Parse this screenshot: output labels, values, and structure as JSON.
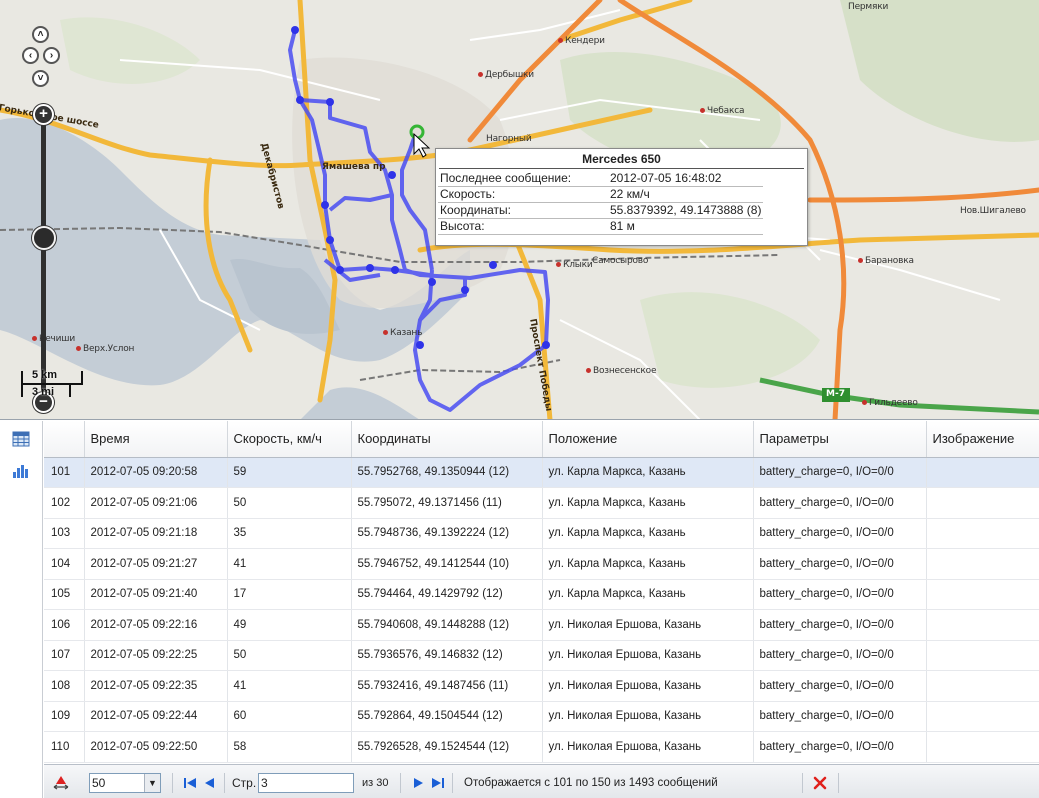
{
  "map": {
    "places": {
      "permyaki": "Пермяки",
      "kendery": "Кендери",
      "derbyshki": "Дербышки",
      "chebaksa": "Чебакса",
      "nagorny": "Нагорный",
      "nov_shigalevo": "Нов.Шигалево",
      "klyki": "Клыки",
      "samosyrovo": "Самосырово",
      "baranovka": "Барановка",
      "kazan": "Казань",
      "verkh_uslon": "Верх.Услон",
      "kurlachi": "Кечиши",
      "voznesenskoe": "Вознесенское",
      "gildeevo": "Гильдеево"
    },
    "roads": {
      "gorkovskoe": "Горьковское шоссе",
      "dekabristov": "Декабристов",
      "yamasheva": "Ямашева пр",
      "pobedy": "Проспект Победы",
      "m7": "М-7"
    },
    "scale": {
      "km": "5 km",
      "mi": "3 mi"
    },
    "controls": {
      "pan_up": "˄",
      "pan_left": "‹",
      "pan_right": "›",
      "pan_down": "˅",
      "zoom_in": "+",
      "zoom_out": "−"
    }
  },
  "popup": {
    "title": "Mercedes 650",
    "rows": [
      {
        "k": "Последнее сообщение:",
        "v": "2012-07-05 16:48:02"
      },
      {
        "k": "Скорость:",
        "v": "22 км/ч"
      },
      {
        "k": "Координаты:",
        "v": "55.8379392, 49.1473888 (8)"
      },
      {
        "k": "Высота:",
        "v": "81 м"
      }
    ]
  },
  "grid": {
    "columns": [
      "",
      "Время",
      "Скорость, км/ч",
      "Координаты",
      "Положение",
      "Параметры",
      "Изображение"
    ],
    "rows": [
      [
        "101",
        "2012-07-05 09:20:58",
        "59",
        "55.7952768, 49.1350944 (12)",
        "ул. Карла Маркса, Казань",
        "battery_charge=0, I/O=0/0",
        ""
      ],
      [
        "102",
        "2012-07-05 09:21:06",
        "50",
        "55.795072, 49.1371456 (11)",
        "ул. Карла Маркса, Казань",
        "battery_charge=0, I/O=0/0",
        ""
      ],
      [
        "103",
        "2012-07-05 09:21:18",
        "35",
        "55.7948736, 49.1392224 (12)",
        "ул. Карла Маркса, Казань",
        "battery_charge=0, I/O=0/0",
        ""
      ],
      [
        "104",
        "2012-07-05 09:21:27",
        "41",
        "55.7946752, 49.1412544 (10)",
        "ул. Карла Маркса, Казань",
        "battery_charge=0, I/O=0/0",
        ""
      ],
      [
        "105",
        "2012-07-05 09:21:40",
        "17",
        "55.794464, 49.1429792 (12)",
        "ул. Карла Маркса, Казань",
        "battery_charge=0, I/O=0/0",
        ""
      ],
      [
        "106",
        "2012-07-05 09:22:16",
        "49",
        "55.7940608, 49.1448288 (12)",
        "ул. Николая Ершова, Казань",
        "battery_charge=0, I/O=0/0",
        ""
      ],
      [
        "107",
        "2012-07-05 09:22:25",
        "50",
        "55.7936576, 49.146832 (12)",
        "ул. Николая Ершова, Казань",
        "battery_charge=0, I/O=0/0",
        ""
      ],
      [
        "108",
        "2012-07-05 09:22:35",
        "41",
        "55.7932416, 49.1487456 (11)",
        "ул. Николая Ершова, Казань",
        "battery_charge=0, I/O=0/0",
        ""
      ],
      [
        "109",
        "2012-07-05 09:22:44",
        "60",
        "55.792864, 49.1504544 (12)",
        "ул. Николая Ершова, Казань",
        "battery_charge=0, I/O=0/0",
        ""
      ],
      [
        "110",
        "2012-07-05 09:22:50",
        "58",
        "55.7926528, 49.1524544 (12)",
        "ул. Николая Ершова, Казань",
        "battery_charge=0, I/O=0/0",
        ""
      ]
    ]
  },
  "pager": {
    "page_size": "50",
    "page_label": "Стр.",
    "page_value": "3",
    "of_pages": "из 30",
    "status": "Отображается с 101 по 150 из 1493 сообщений"
  },
  "icons": {
    "calendar": "table-grid-icon",
    "chart": "bar-chart-icon"
  },
  "colors": {
    "track": "#4a4ef2",
    "highlight_row": "#dfe8f6",
    "clear_red": "#e0201b",
    "nav_blue": "#1a5fd6"
  }
}
